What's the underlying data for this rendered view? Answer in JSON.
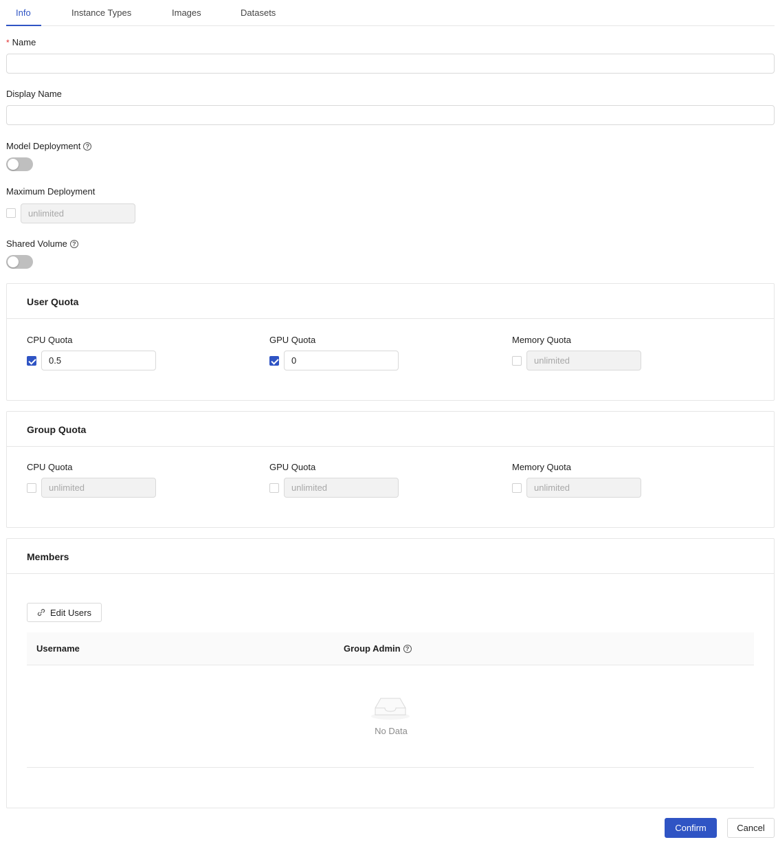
{
  "tabs": [
    {
      "label": "Info"
    },
    {
      "label": "Instance Types"
    },
    {
      "label": "Images"
    },
    {
      "label": "Datasets"
    }
  ],
  "active_tab": "Info",
  "accent_color": "#2f54c4",
  "form": {
    "name": {
      "label": "Name",
      "required_mark": "*",
      "value": ""
    },
    "display_name": {
      "label": "Display Name",
      "value": ""
    },
    "model_deployment": {
      "label": "Model Deployment",
      "help_icon": "question-circle-icon",
      "enabled": false
    },
    "maximum_deployment": {
      "label": "Maximum Deployment",
      "checked": false,
      "placeholder": "unlimited"
    },
    "shared_volume": {
      "label": "Shared Volume",
      "help_icon": "question-circle-icon",
      "enabled": false
    }
  },
  "user_quota": {
    "title": "User Quota",
    "cpu": {
      "label": "CPU Quota",
      "checked": true,
      "value": "0.5"
    },
    "gpu": {
      "label": "GPU Quota",
      "checked": true,
      "value": "0"
    },
    "memory": {
      "label": "Memory Quota",
      "checked": false,
      "placeholder": "unlimited"
    }
  },
  "group_quota": {
    "title": "Group Quota",
    "cpu": {
      "label": "CPU Quota",
      "checked": false,
      "placeholder": "unlimited"
    },
    "gpu": {
      "label": "GPU Quota",
      "checked": false,
      "placeholder": "unlimited"
    },
    "memory": {
      "label": "Memory Quota",
      "checked": false,
      "placeholder": "unlimited"
    }
  },
  "members": {
    "title": "Members",
    "edit_users_label": "Edit Users",
    "edit_users_icon": "link-icon",
    "columns": [
      "Username",
      "Group Admin"
    ],
    "rows": [],
    "empty_text": "No Data"
  },
  "footer": {
    "confirm_label": "Confirm",
    "cancel_label": "Cancel"
  }
}
